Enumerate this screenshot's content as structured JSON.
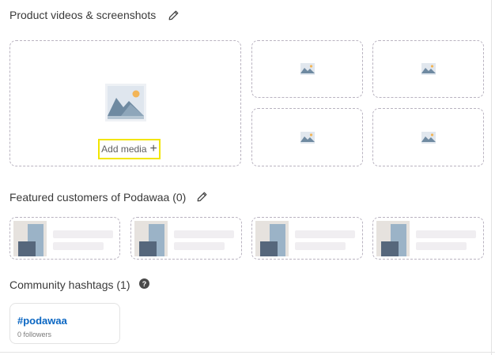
{
  "media": {
    "title": "Product videos & screenshots",
    "add_label": "Add media",
    "add_icon": "plus-icon",
    "edit_icon": "pencil-icon",
    "slot_icon": "image-placeholder-icon"
  },
  "customers": {
    "title": "Featured customers of Podawaa (0)",
    "edit_icon": "pencil-icon"
  },
  "hashtags": {
    "title": "Community hashtags (1)",
    "help_icon": "question-circle-icon",
    "items": [
      {
        "tag": "#podawaa",
        "followers": "0 followers"
      }
    ]
  },
  "colors": {
    "link": "#0a66c2",
    "highlight": "#f2e500",
    "dashed_border": "#b9b3c0"
  }
}
